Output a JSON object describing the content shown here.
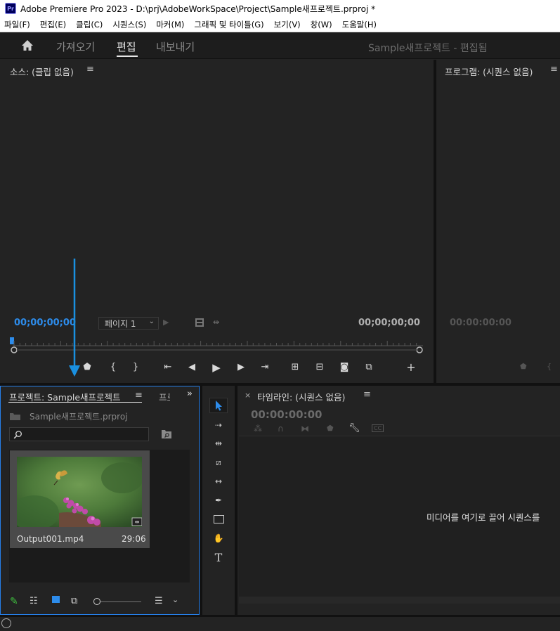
{
  "window": {
    "app_icon": "Pr",
    "title": "Adobe Premiere Pro 2023 - D:\\prj\\AdobeWorkSpace\\Project\\Sample새프로젝트.prproj *"
  },
  "menu": [
    "파일(F)",
    "편집(E)",
    "클립(C)",
    "시퀀스(S)",
    "마커(M)",
    "그래픽 및 타이틀(G)",
    "보기(V)",
    "창(W)",
    "도움말(H)"
  ],
  "header": {
    "workspaces": [
      "가져오기",
      "편집",
      "내보내기"
    ],
    "active_workspace": "편집",
    "project_title": "Sample새프로젝트 - 편집됨"
  },
  "source": {
    "title": "소스: (클립 없음)",
    "timecode_in": "00;00;00;00",
    "timecode_out": "00;00;00;00",
    "page": "페이지 1"
  },
  "program": {
    "title": "프로그램: (시퀀스 없음)",
    "timecode": "00:00:00:00"
  },
  "project": {
    "tab_title": "프로젝트: Sample새프로젝트",
    "tab2_title": "프로",
    "file_name": "Sample새프로젝트.prproj",
    "search_placeholder": "",
    "clip_name": "Output001.mp4",
    "clip_duration": "29:06"
  },
  "timeline": {
    "title": "타임라인: (시퀀스 없음)",
    "timecode": "00:00:00:00",
    "drop_hint": "미디어를 여기로 끌어 시퀀스를"
  },
  "colors": {
    "accent_blue": "#2680eb",
    "timecode_blue": "#2d8ceb",
    "arrow_annotation": "#1a90e0"
  }
}
